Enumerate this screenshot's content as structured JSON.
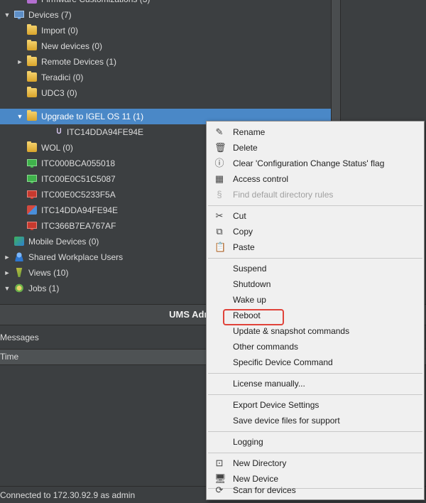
{
  "tree": {
    "top_partial": "Firmware Customizations (3)",
    "items": [
      {
        "label": "Devices (7)",
        "expanded": true
      },
      {
        "label": "Import (0)"
      },
      {
        "label": "New devices (0)"
      },
      {
        "label": "Remote Devices (1)",
        "collapsed": true
      },
      {
        "label": "Teradici (0)"
      },
      {
        "label": "UDC3 (0)"
      },
      {
        "label": "Upgrade to IGEL OS 11 (1)",
        "expanded": true,
        "selected": true
      },
      {
        "label": "ITC14DDA94FE94E"
      },
      {
        "label": "WOL (0)"
      },
      {
        "label": "ITC000BCA055018"
      },
      {
        "label": "ITC00E0C51C5087"
      },
      {
        "label": "ITC00E0C5233F5A"
      },
      {
        "label": "ITC14DDA94FE94E"
      },
      {
        "label": "ITC366B7EA767AF"
      },
      {
        "label": "Mobile Devices (0)"
      },
      {
        "label": "Shared Workplace Users",
        "collapsed": true
      },
      {
        "label": "Views (10)",
        "collapsed": true
      },
      {
        "label": "Jobs (1)",
        "expanded": true
      }
    ]
  },
  "bottom": {
    "header": "UMS Administration",
    "messages_title": "Messages",
    "time_column": "Time",
    "status": "Connected to 172.30.92.9 as admin"
  },
  "context_menu": {
    "items": [
      {
        "label": "Rename",
        "icon": "pencil-icon"
      },
      {
        "label": "Delete",
        "icon": "trash-icon"
      },
      {
        "label": "Clear 'Configuration Change Status' flag",
        "icon": "alert-icon"
      },
      {
        "label": "Access control",
        "icon": "access-control-icon"
      },
      {
        "label": "Find default directory rules",
        "icon": "rules-icon",
        "disabled": true
      },
      {
        "label": "Cut",
        "icon": "scissors-icon"
      },
      {
        "label": "Copy",
        "icon": "copy-icon"
      },
      {
        "label": "Paste",
        "icon": "paste-icon"
      },
      {
        "label": "Suspend"
      },
      {
        "label": "Shutdown"
      },
      {
        "label": "Wake up"
      },
      {
        "label": "Reboot",
        "highlighted": true
      },
      {
        "label": "Update & snapshot commands"
      },
      {
        "label": "Other commands"
      },
      {
        "label": "Specific Device Command"
      },
      {
        "label": "License manually..."
      },
      {
        "label": "Export Device Settings"
      },
      {
        "label": "Save device files for support"
      },
      {
        "label": "Logging"
      },
      {
        "label": "New Directory",
        "icon": "new-directory-icon"
      },
      {
        "label": "New Device",
        "icon": "monitor-icon"
      },
      {
        "label": "Scan for devices",
        "icon": "scan-icon"
      }
    ]
  },
  "colors": {
    "panel_bg": "#3c3f41",
    "selection": "#4a88c7",
    "menu_bg": "#f0f0f0",
    "highlight_box": "#e0433a"
  }
}
